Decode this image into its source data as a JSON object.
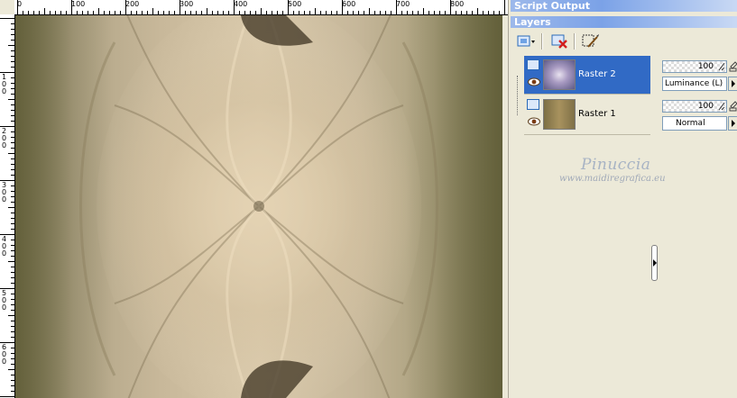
{
  "ruler": {
    "top_labels": [
      "0",
      "100",
      "200",
      "300",
      "400",
      "500",
      "600",
      "700",
      "800"
    ],
    "left_labels": [
      "100",
      "200",
      "300",
      "400",
      "500",
      "600"
    ]
  },
  "panels": {
    "script_output": {
      "title": "Script Output"
    },
    "layers": {
      "title": "Layers",
      "toolbar": [
        {
          "name": "new-layer",
          "icon": "new-layer-icon"
        },
        {
          "name": "delete-layer",
          "icon": "delete-layer-icon"
        },
        {
          "name": "layer-properties",
          "icon": "layer-properties-icon"
        }
      ],
      "items": [
        {
          "name": "Raster 2",
          "selected": true,
          "opacity": "100",
          "blend_mode": "Luminance (L)"
        },
        {
          "name": "Raster 1",
          "selected": false,
          "opacity": "100",
          "blend_mode": "Normal"
        }
      ]
    }
  },
  "watermark": {
    "name": "Pinuccia",
    "url": "www.maidiregrafica.eu"
  },
  "colors": {
    "selection": "#316ac5",
    "panel_bg": "#ece9d8",
    "title_gradient_start": "#9db9eb",
    "canvas_dark": "#6e6a43",
    "canvas_light": "#d8c8aa"
  }
}
